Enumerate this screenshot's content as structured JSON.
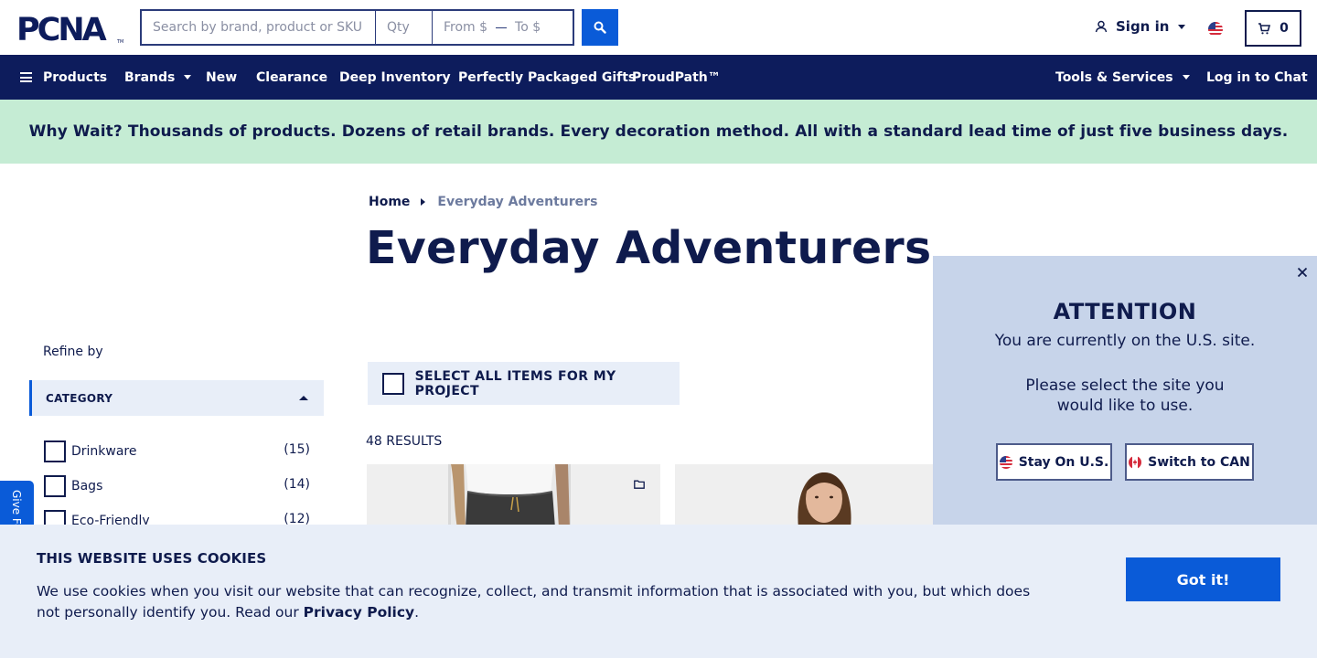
{
  "header": {
    "logo_text": "PCNA",
    "search": {
      "placeholder": "Search by brand, product or SKU",
      "value": ""
    },
    "qty": {
      "placeholder": "Qty",
      "value": ""
    },
    "price_from": "From $",
    "price_to": "To $",
    "sign_in_label": "Sign in",
    "cart_count": "0",
    "icons": {
      "search": "search-icon",
      "user": "user-icon",
      "flag": "us-flag-icon",
      "cart": "cart-icon"
    }
  },
  "nav": {
    "products_label": "Products",
    "items": [
      "Brands",
      "New",
      "Clearance",
      "Deep Inventory",
      "Perfectly Packaged Gifts",
      "ProudPath™"
    ],
    "tools_label": "Tools & Services",
    "chat_label": "Log in to Chat"
  },
  "promo": {
    "text": "Why Wait? Thousands of products. Dozens of retail brands. Every decoration method. All with a standard lead time of just five business days."
  },
  "breadcrumb": {
    "home": "Home",
    "current": "Everyday Adventurers"
  },
  "page_title": "Everyday Adventurers",
  "sidebar": {
    "refine_label": "Refine by",
    "category_header": "CATEGORY",
    "categories": [
      {
        "label": "Drinkware",
        "count": "(15)"
      },
      {
        "label": "Bags",
        "count": "(14)"
      },
      {
        "label": "Eco-Friendly",
        "count": "(12)"
      }
    ],
    "feedback_label": "Give Feedback"
  },
  "main": {
    "select_all_label": "SELECT ALL ITEMS FOR MY PROJECT",
    "results_label": "48 RESULTS"
  },
  "modal": {
    "title": "ATTENTION",
    "line1": "You are currently on the U.S. site.",
    "line2": "Please select the site you",
    "line3": "would like to use.",
    "stay_label": "Stay On U.S.",
    "switch_label": "Switch to CAN"
  },
  "cookie": {
    "title": "THIS WEBSITE USES COOKIES",
    "body_prefix": "We use cookies when you visit our website that can recognize, collect, and transmit information that is associated with you, but which does not personally identify you. Read our ",
    "policy_link": "Privacy Policy",
    "body_suffix": ".",
    "button_label": "Got it!"
  },
  "colors": {
    "navy": "#0d1c5c",
    "accent_blue": "#0a5bd8",
    "promo_green": "#c5ecd4",
    "light_panel": "#e8eef8",
    "modal_bg": "#c7d4ea"
  }
}
